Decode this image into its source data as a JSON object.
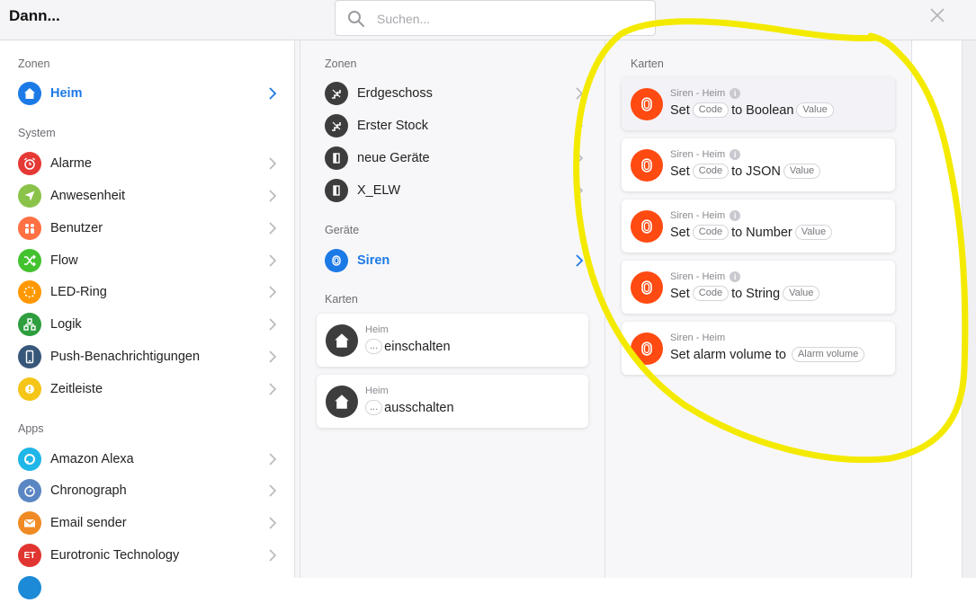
{
  "header": {
    "title": "Dann...",
    "search_placeholder": "Suchen..."
  },
  "col1": {
    "zonen_label": "Zonen",
    "zonen_item": {
      "label": "Heim"
    },
    "system_label": "System",
    "system_items": [
      {
        "label": "Alarme",
        "color": "#e53935"
      },
      {
        "label": "Anwesenheit",
        "color": "#8bc34a"
      },
      {
        "label": "Benutzer",
        "color": "#ff7043"
      },
      {
        "label": "Flow",
        "color": "#43c22f"
      },
      {
        "label": "LED-Ring",
        "color": "#ff9800"
      },
      {
        "label": "Logik",
        "color": "#2e9e3e"
      },
      {
        "label": "Push-Benachrichtigungen",
        "color": "#37577a"
      },
      {
        "label": "Zeitleiste",
        "color": "#f5c518"
      }
    ],
    "apps_label": "Apps",
    "apps_items": [
      {
        "label": "Amazon Alexa",
        "color": "#1fb6e8"
      },
      {
        "label": "Chronograph",
        "color": "#5b86c4"
      },
      {
        "label": "Email sender",
        "color": "#f08a24"
      },
      {
        "label": "Eurotronic Technology",
        "color": "#e03530",
        "icon_text": "ET"
      }
    ]
  },
  "col2": {
    "zonen_label": "Zonen",
    "zonen_items": [
      {
        "label": "Erdgeschoss"
      },
      {
        "label": "Erster Stock"
      },
      {
        "label": "neue Geräte"
      },
      {
        "label": "X_ELW"
      }
    ],
    "geraete_label": "Geräte",
    "geraete_item": {
      "label": "Siren"
    },
    "karten_label": "Karten",
    "cards": [
      {
        "sub": "Heim",
        "pill": "...",
        "text": "einschalten"
      },
      {
        "sub": "Heim",
        "pill": "...",
        "text": "ausschalten"
      }
    ]
  },
  "col3": {
    "karten_label": "Karten",
    "cards": [
      {
        "sub": "Siren - Heim",
        "info": "i",
        "w1": "Set",
        "pill1": "Code",
        "w2": "to Boolean",
        "pill2": "Value"
      },
      {
        "sub": "Siren - Heim",
        "info": "i",
        "w1": "Set",
        "pill1": "Code",
        "w2": "to JSON",
        "pill2": "Value"
      },
      {
        "sub": "Siren - Heim",
        "info": "i",
        "w1": "Set",
        "pill1": "Code",
        "w2": "to Number",
        "pill2": "Value"
      },
      {
        "sub": "Siren - Heim",
        "info": "i",
        "w1": "Set",
        "pill1": "Code",
        "w2": "to String",
        "pill2": "Value"
      }
    ],
    "last_card": {
      "sub": "Siren - Heim",
      "text": "Set alarm volume to",
      "pill": "Alarm volume"
    }
  },
  "colors": {
    "accent": "#1c7ae6",
    "siren": "#ff4a12",
    "highlight": "#f4ea00",
    "dark_icon": "#3d3d3d"
  }
}
